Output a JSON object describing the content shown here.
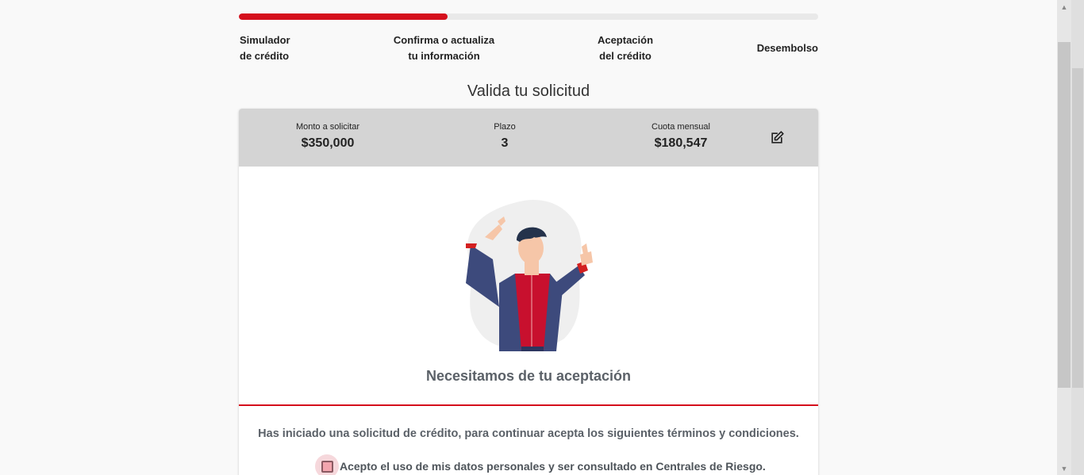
{
  "progress": {
    "fraction": 0.36,
    "color": "#d50f1c"
  },
  "steps": [
    {
      "line1": "Simulador",
      "line2": "de crédito"
    },
    {
      "line1": "Confirma o actualiza",
      "line2": "tu información"
    },
    {
      "line1": "Aceptación",
      "line2": "del crédito"
    },
    {
      "line1": "Desembolso",
      "line2": ""
    }
  ],
  "page_title": "Valida tu solicitud",
  "summary": {
    "amount_label": "Monto a solicitar",
    "amount_value": "$350,000",
    "term_label": "Plazo",
    "term_value": "3",
    "fee_label": "Cuota mensual",
    "fee_value": "$180,547",
    "edit_icon": "edit-icon"
  },
  "acceptance": {
    "title": "Necesitamos de tu aceptación",
    "terms_text": "Has iniciado una solicitud de crédito, para continuar acepta los siguientes términos y condiciones.",
    "checkbox_label": "Acepto el uso de mis datos personales y ser consultado en Centrales de Riesgo."
  },
  "colors": {
    "accent": "#d50f1c",
    "summary_bg": "#d4d4d4",
    "text_muted": "#5b6168"
  }
}
